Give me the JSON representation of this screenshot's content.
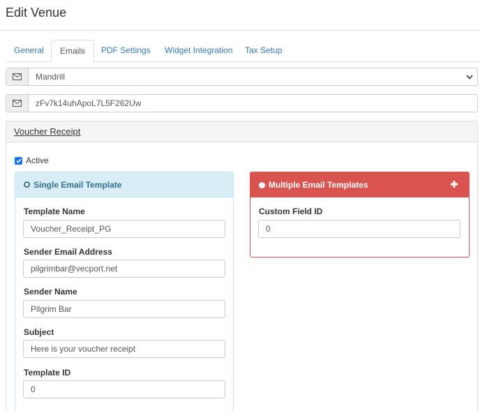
{
  "page": {
    "title": "Edit Venue"
  },
  "tabs": [
    {
      "label": "General",
      "active": false
    },
    {
      "label": "Emails",
      "active": true
    },
    {
      "label": "PDF Settings",
      "active": false
    },
    {
      "label": "Widget Integration",
      "active": false
    },
    {
      "label": "Tax Setup",
      "active": false
    }
  ],
  "provider": {
    "selected": "Mandrill",
    "icon": "envelope-icon"
  },
  "api_key": {
    "value": "zFv7k14uhApoL7L5F262Uw",
    "icon": "envelope-icon"
  },
  "voucher_panel": {
    "heading": "Voucher Receipt",
    "active_label": "Active",
    "active_checked": true,
    "single": {
      "heading": "Single Email Template",
      "fields": [
        {
          "label": "Template Name",
          "value": "Voucher_Receipt_PG"
        },
        {
          "label": "Sender Email Address",
          "value": "pilgrimbar@vecport.net"
        },
        {
          "label": "Sender Name",
          "value": "Pilgrim Bar"
        },
        {
          "label": "Subject",
          "value": "Here is your voucher receipt"
        },
        {
          "label": "Template ID",
          "value": "0"
        }
      ]
    },
    "multiple": {
      "heading": "Multiple Email Templates",
      "field_label": "Custom Field ID",
      "field_value": "0"
    }
  },
  "colors": {
    "link": "#337ab7",
    "info_bg": "#d9edf7",
    "info_border": "#bce8f1",
    "danger": "#d9534f",
    "checkbox": "#1a73e8"
  }
}
